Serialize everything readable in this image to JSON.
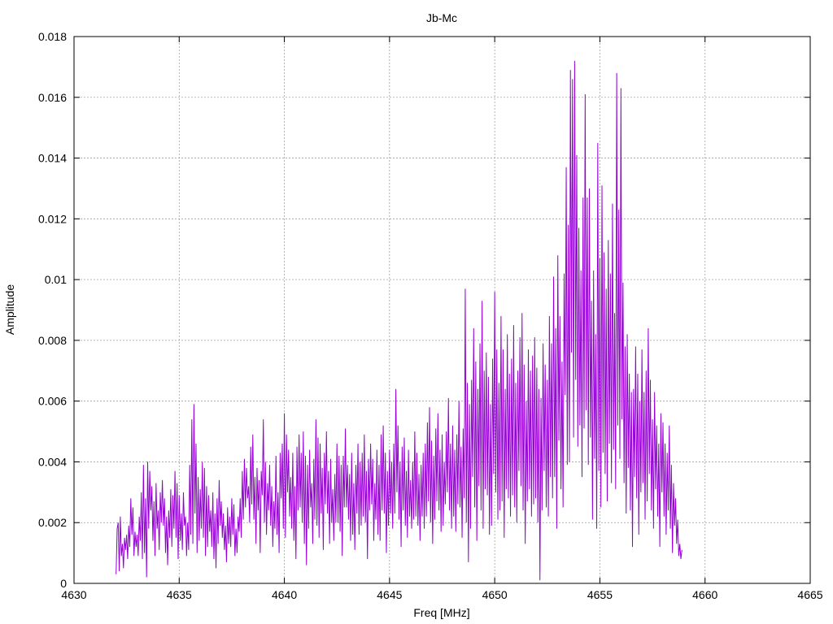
{
  "chart_data": {
    "type": "line",
    "title": "Jb-Mc",
    "xlabel": "Freq [MHz]",
    "ylabel": "Amplitude",
    "xlim": [
      4630,
      4665
    ],
    "ylim": [
      0,
      0.018
    ],
    "xticks": [
      4630,
      4635,
      4640,
      4645,
      4650,
      4655,
      4660,
      4665
    ],
    "xtick_labels": [
      "4630",
      "4635",
      "4640",
      "4645",
      "4650",
      "4655",
      "4660",
      "4665"
    ],
    "yticks": [
      0,
      0.002,
      0.004,
      0.006,
      0.008,
      0.01,
      0.012,
      0.014,
      0.016,
      0.018
    ],
    "ytick_labels": [
      "0",
      "0.002",
      "0.004",
      "0.006",
      "0.008",
      "0.01",
      "0.012",
      "0.014",
      "0.016",
      "0.018"
    ],
    "grid": true,
    "series": [
      {
        "color": "#9400d3",
        "x_start": 4632,
        "x_step": 0.05,
        "values": [
          0.0003,
          0.0018,
          0.002,
          0.0004,
          0.0022,
          0.0009,
          0.0013,
          0.0005,
          0.0015,
          0.0011,
          0.0016,
          0.0008,
          0.0019,
          0.0012,
          0.0028,
          0.0016,
          0.0025,
          0.0009,
          0.0017,
          0.0012,
          0.0016,
          0.0009,
          0.0022,
          0.0014,
          0.003,
          0.0008,
          0.0039,
          0.001,
          0.0028,
          0.0002,
          0.004,
          0.0018,
          0.0037,
          0.0024,
          0.0032,
          0.0014,
          0.0027,
          0.0009,
          0.0033,
          0.0018,
          0.0024,
          0.0011,
          0.003,
          0.002,
          0.0034,
          0.0019,
          0.0028,
          0.001,
          0.0022,
          0.0006,
          0.0024,
          0.0015,
          0.0031,
          0.0012,
          0.0029,
          0.0018,
          0.0037,
          0.0015,
          0.0033,
          0.0008,
          0.0029,
          0.0014,
          0.0023,
          0.0011,
          0.003,
          0.0019,
          0.0022,
          0.0009,
          0.002,
          0.0011,
          0.0039,
          0.0016,
          0.0054,
          0.0013,
          0.0059,
          0.0023,
          0.0046,
          0.001,
          0.0035,
          0.0014,
          0.0031,
          0.0018,
          0.004,
          0.0015,
          0.0038,
          0.0009,
          0.0032,
          0.0012,
          0.0029,
          0.0017,
          0.0024,
          0.0012,
          0.003,
          0.0008,
          0.0023,
          0.0005,
          0.0028,
          0.0013,
          0.0034,
          0.0019,
          0.0027,
          0.0015,
          0.0023,
          0.0011,
          0.0019,
          0.0007,
          0.0025,
          0.0013,
          0.0022,
          0.0012,
          0.0028,
          0.0016,
          0.0026,
          0.0009,
          0.0018,
          0.001,
          0.0022,
          0.0017,
          0.0028,
          0.0015,
          0.0037,
          0.0021,
          0.0041,
          0.0025,
          0.0038,
          0.0028,
          0.0032,
          0.002,
          0.0045,
          0.0026,
          0.0049,
          0.0021,
          0.0035,
          0.0013,
          0.0038,
          0.0024,
          0.0034,
          0.001,
          0.0037,
          0.0029,
          0.0054,
          0.002,
          0.004,
          0.0016,
          0.0033,
          0.0024,
          0.0039,
          0.0019,
          0.0032,
          0.0012,
          0.0027,
          0.0018,
          0.0042,
          0.0016,
          0.003,
          0.001,
          0.0043,
          0.0028,
          0.0046,
          0.0018,
          0.0056,
          0.0015,
          0.0049,
          0.003,
          0.0044,
          0.0022,
          0.0035,
          0.0018,
          0.0043,
          0.0014,
          0.0032,
          0.0008,
          0.0045,
          0.0024,
          0.0049,
          0.0025,
          0.0043,
          0.002,
          0.005,
          0.0013,
          0.0042,
          0.0006,
          0.0039,
          0.0018,
          0.0044,
          0.0025,
          0.0033,
          0.0013,
          0.0041,
          0.0021,
          0.0054,
          0.0019,
          0.0048,
          0.0015,
          0.0046,
          0.0023,
          0.0038,
          0.0011,
          0.0043,
          0.0026,
          0.005,
          0.0023,
          0.0037,
          0.0013,
          0.0041,
          0.002,
          0.0031,
          0.0014,
          0.0036,
          0.002,
          0.0046,
          0.002,
          0.0042,
          0.0017,
          0.0039,
          0.0009,
          0.0042,
          0.0025,
          0.0051,
          0.0025,
          0.0039,
          0.0021,
          0.0036,
          0.0014,
          0.0043,
          0.0016,
          0.0033,
          0.0011,
          0.0039,
          0.0023,
          0.0046,
          0.0016,
          0.004,
          0.0019,
          0.0043,
          0.0022,
          0.0049,
          0.002,
          0.0037,
          0.0008,
          0.0041,
          0.0024,
          0.0046,
          0.0026,
          0.0041,
          0.0014,
          0.0033,
          0.0021,
          0.0044,
          0.0016,
          0.0039,
          0.0014,
          0.0049,
          0.0024,
          0.0052,
          0.0023,
          0.0043,
          0.001,
          0.0037,
          0.0019,
          0.0044,
          0.0023,
          0.004,
          0.0018,
          0.0046,
          0.0023,
          0.0064,
          0.003,
          0.0052,
          0.0021,
          0.004,
          0.0012,
          0.0045,
          0.0024,
          0.0048,
          0.0019,
          0.0037,
          0.0015,
          0.0044,
          0.0022,
          0.0034,
          0.0018,
          0.004,
          0.0021,
          0.005,
          0.0022,
          0.0043,
          0.0019,
          0.0036,
          0.0014,
          0.0039,
          0.0022,
          0.0043,
          0.0018,
          0.0046,
          0.0022,
          0.0053,
          0.0027,
          0.0058,
          0.002,
          0.0047,
          0.0013,
          0.0042,
          0.0021,
          0.0051,
          0.0027,
          0.0056,
          0.0024,
          0.0044,
          0.0017,
          0.0049,
          0.0019,
          0.004,
          0.0026,
          0.005,
          0.003,
          0.0061,
          0.0024,
          0.0046,
          0.0018,
          0.0052,
          0.0022,
          0.0044,
          0.0017,
          0.0049,
          0.0026,
          0.006,
          0.0025,
          0.0045,
          0.0015,
          0.0051,
          0.0028,
          0.0097,
          0.002,
          0.0066,
          0.0007,
          0.0059,
          0.0018,
          0.0067,
          0.0035,
          0.0084,
          0.0025,
          0.0073,
          0.0014,
          0.0064,
          0.0032,
          0.0079,
          0.0024,
          0.0093,
          0.0018,
          0.007,
          0.0031,
          0.0076,
          0.0029,
          0.0068,
          0.0016,
          0.0059,
          0.0019,
          0.0074,
          0.0036,
          0.0096,
          0.003,
          0.0077,
          0.0021,
          0.0066,
          0.0024,
          0.0088,
          0.0027,
          0.0077,
          0.0015,
          0.0064,
          0.0031,
          0.0082,
          0.0028,
          0.0069,
          0.0022,
          0.0074,
          0.0029,
          0.0085,
          0.0025,
          0.0066,
          0.002,
          0.007,
          0.0037,
          0.0081,
          0.0032,
          0.0089,
          0.0024,
          0.0072,
          0.0013,
          0.006,
          0.0027,
          0.0077,
          0.0031,
          0.007,
          0.0022,
          0.0075,
          0.0026,
          0.0081,
          0.0028,
          0.0071,
          0.002,
          0.0064,
          0.0001,
          0.0061,
          0.0024,
          0.0079,
          0.0037,
          0.0072,
          0.0025,
          0.0067,
          0.0022,
          0.0088,
          0.0035,
          0.0079,
          0.0028,
          0.0101,
          0.0035,
          0.0084,
          0.0018,
          0.0108,
          0.0047,
          0.0088,
          0.0031,
          0.0073,
          0.0025,
          0.0102,
          0.0062,
          0.0137,
          0.0039,
          0.0118,
          0.004,
          0.0169,
          0.0076,
          0.0166,
          0.0048,
          0.0172,
          0.0067,
          0.0141,
          0.0045,
          0.0117,
          0.0052,
          0.0103,
          0.0035,
          0.0127,
          0.0051,
          0.0161,
          0.0057,
          0.0127,
          0.0039,
          0.013,
          0.0048,
          0.0093,
          0.0021,
          0.0103,
          0.0041,
          0.0082,
          0.0018,
          0.0145,
          0.0037,
          0.0107,
          0.0025,
          0.0131,
          0.0043,
          0.0109,
          0.0036,
          0.0097,
          0.0027,
          0.0113,
          0.0046,
          0.0102,
          0.0033,
          0.0125,
          0.0044,
          0.0089,
          0.0031,
          0.0168,
          0.0052,
          0.0123,
          0.0041,
          0.0163,
          0.0054,
          0.0099,
          0.0033,
          0.0078,
          0.0023,
          0.0082,
          0.0038,
          0.0069,
          0.0024,
          0.0063,
          0.0012,
          0.0064,
          0.0035,
          0.0078,
          0.0028,
          0.0069,
          0.0016,
          0.006,
          0.003,
          0.0077,
          0.0033,
          0.0063,
          0.0021,
          0.007,
          0.0027,
          0.0084,
          0.0036,
          0.0067,
          0.0024,
          0.0054,
          0.0018,
          0.0063,
          0.0031,
          0.0052,
          0.0022,
          0.0046,
          0.0012,
          0.0056,
          0.003,
          0.0053,
          0.0022,
          0.0046,
          0.0016,
          0.0043,
          0.0024,
          0.0052,
          0.0018,
          0.0039,
          0.001,
          0.0033,
          0.0019,
          0.0028,
          0.0013,
          0.0021,
          0.0009,
          0.0013,
          0.0008,
          0.0011
        ]
      }
    ]
  }
}
